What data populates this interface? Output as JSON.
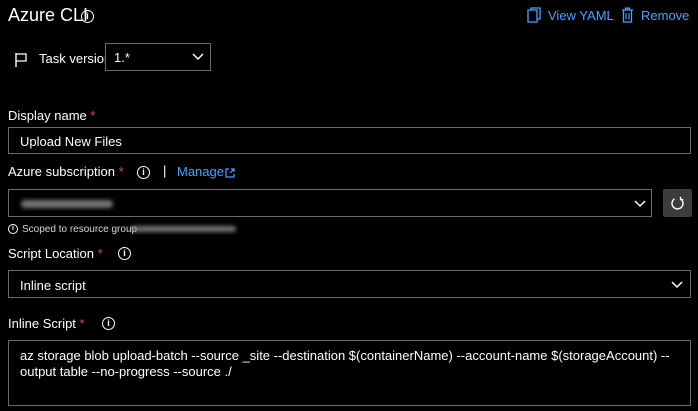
{
  "header": {
    "title": "Azure CLI",
    "view_yaml_label": "View YAML",
    "remove_label": "Remove"
  },
  "task_version": {
    "label": "Task version",
    "value": "1.*"
  },
  "display_name": {
    "label": "Display name",
    "required_marker": "*",
    "value": "Upload New Files"
  },
  "azure_subscription": {
    "label": "Azure subscription",
    "required_marker": "*",
    "separator": "|",
    "manage_label": "Manage",
    "scoped_text": "Scoped to resource group"
  },
  "script_location": {
    "label": "Script Location",
    "required_marker": "*",
    "value": "Inline script"
  },
  "inline_script": {
    "label": "Inline Script",
    "required_marker": "*",
    "value": "az storage blob upload-batch --source _site --destination $(containerName) --account-name $(storageAccount) --output table --no-progress --source ./"
  },
  "colors": {
    "accent": "#4aa0ff",
    "required": "#e04848",
    "background": "#000000",
    "border": "#6b6b6b"
  },
  "icons": [
    "info-icon",
    "view-yaml-icon",
    "trash-icon",
    "flag-icon",
    "chevron-down-icon",
    "external-link-icon",
    "refresh-icon"
  ]
}
